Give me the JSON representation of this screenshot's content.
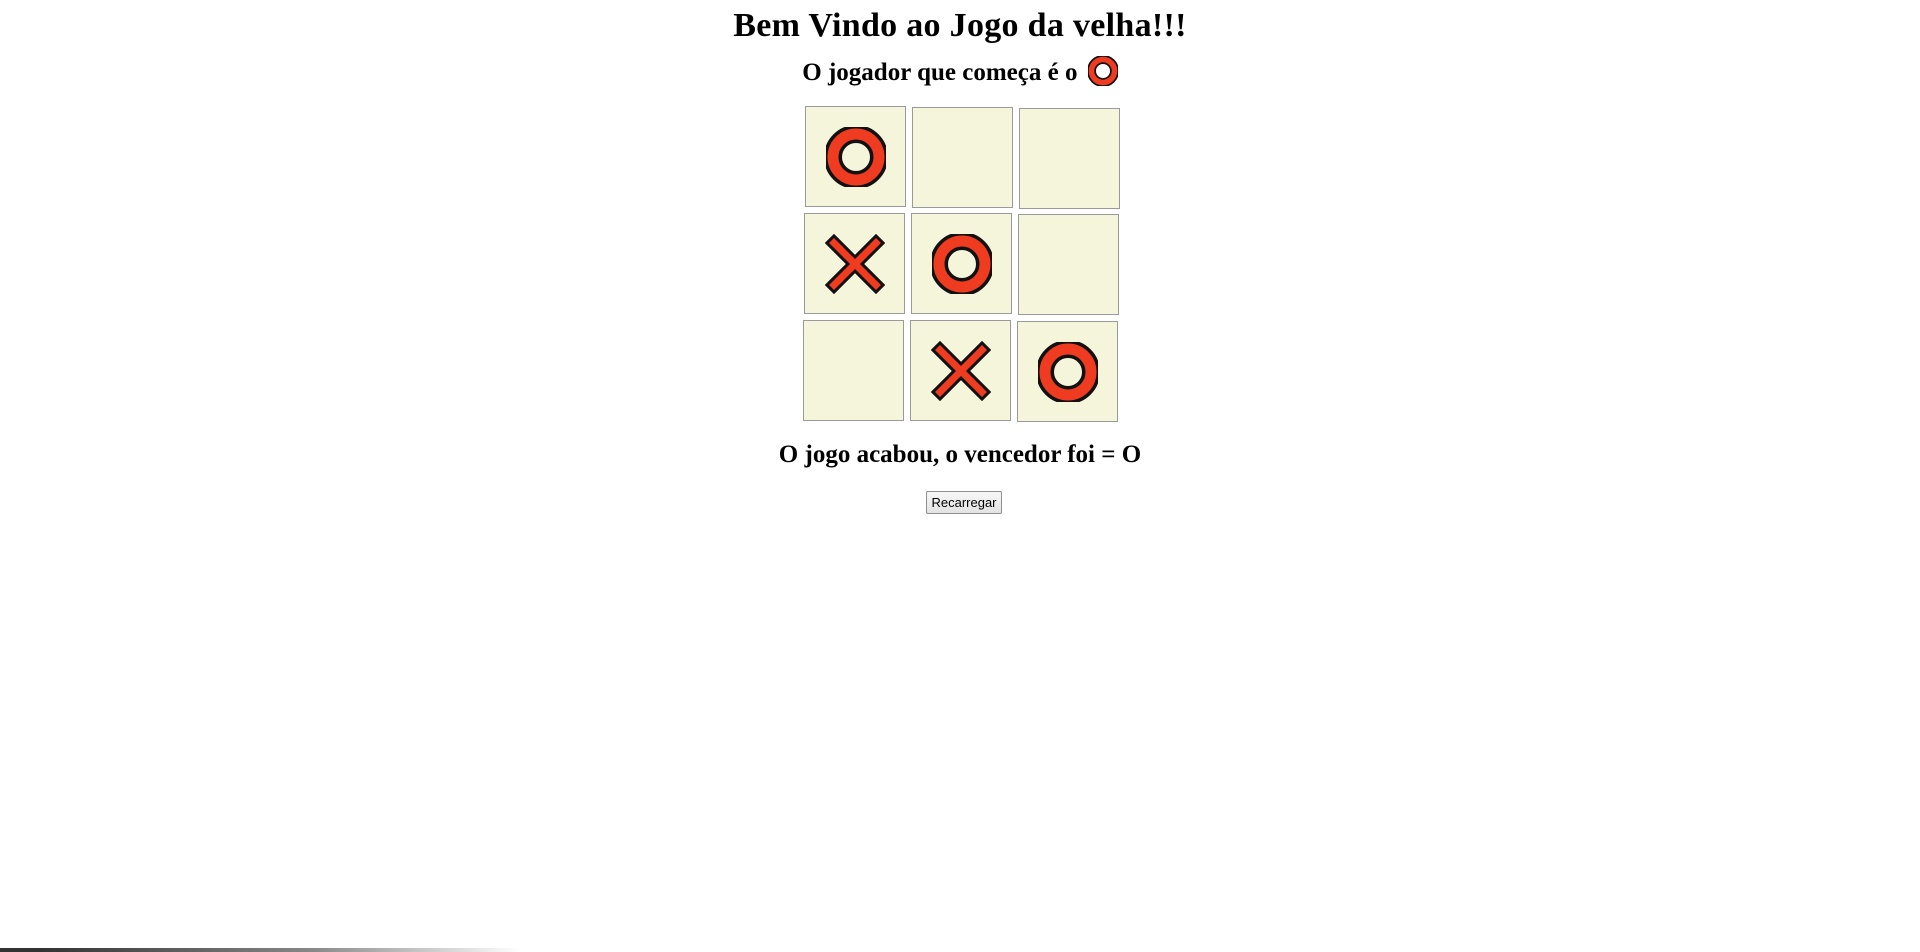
{
  "title": "Bem Vindo ao Jogo da velha!!!",
  "starter": {
    "text": "O jogador que começa é o",
    "icon": "o-mark-icon"
  },
  "colors": {
    "mark_fill": "#ef3b1f",
    "mark_outline": "#111111",
    "cell_background": "#f5f5dc",
    "cell_border": "#9a9a9a"
  },
  "board": {
    "cells": [
      {
        "row": 1,
        "col": 1,
        "mark": "O"
      },
      {
        "row": 1,
        "col": 2,
        "mark": ""
      },
      {
        "row": 1,
        "col": 3,
        "mark": ""
      },
      {
        "row": 2,
        "col": 1,
        "mark": "X"
      },
      {
        "row": 2,
        "col": 2,
        "mark": "O"
      },
      {
        "row": 2,
        "col": 3,
        "mark": ""
      },
      {
        "row": 3,
        "col": 1,
        "mark": ""
      },
      {
        "row": 3,
        "col": 2,
        "mark": "X"
      },
      {
        "row": 3,
        "col": 3,
        "mark": "O"
      }
    ]
  },
  "result": {
    "text": "O jogo acabou, o vencedor foi = O"
  },
  "reload_button": {
    "label": "Recarregar"
  }
}
